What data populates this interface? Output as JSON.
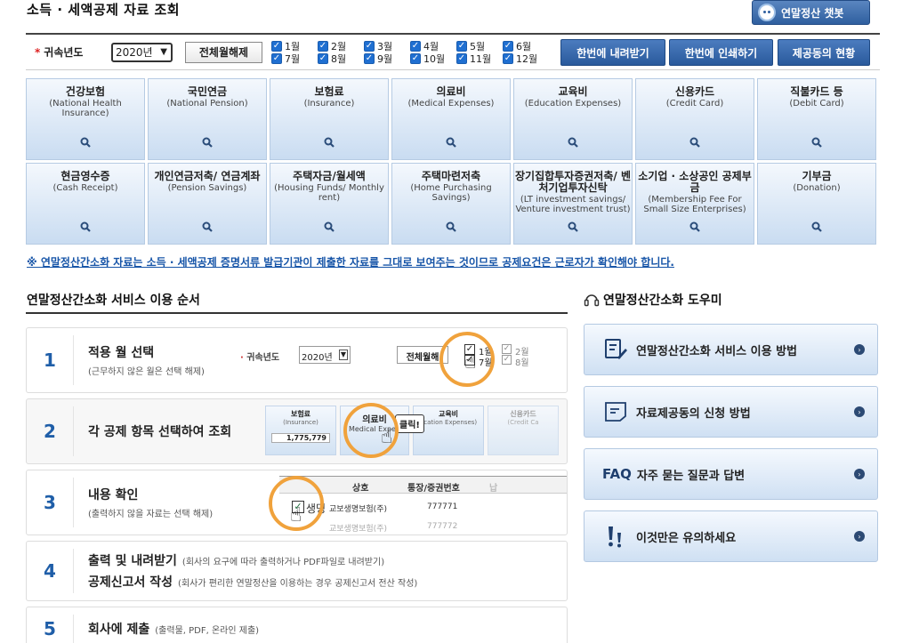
{
  "header": {
    "title": "소득 · 세액공제 자료 조회",
    "chatbot_label": "연말정산 챗봇"
  },
  "filter": {
    "year_label": "귀속년도",
    "required_mark": "*",
    "year_value": "2020년",
    "release_all": "전체월해제",
    "months": [
      "1월",
      "2월",
      "3월",
      "4월",
      "5월",
      "6월",
      "7월",
      "8월",
      "9월",
      "10월",
      "11월",
      "12월"
    ],
    "buttons": {
      "download_all": "한번에 내려받기",
      "print_all": "한번에 인쇄하기",
      "provider_status": "제공동의 현황"
    }
  },
  "categories": [
    {
      "ko": "건강보험",
      "en": "(National Health Insurance)"
    },
    {
      "ko": "국민연금",
      "en": "(National Pension)"
    },
    {
      "ko": "보험료",
      "en": "(Insurance)"
    },
    {
      "ko": "의료비",
      "en": "(Medical Expenses)"
    },
    {
      "ko": "교육비",
      "en": "(Education Expenses)"
    },
    {
      "ko": "신용카드",
      "en": "(Credit Card)"
    },
    {
      "ko": "직불카드 등",
      "en": "(Debit Card)"
    },
    {
      "ko": "현금영수증",
      "en": "(Cash Receipt)"
    },
    {
      "ko": "개인연금저축/ 연금계좌",
      "en": "(Pension Savings)"
    },
    {
      "ko": "주택자금/월세액",
      "en": "(Housing Funds/ Monthly rent)"
    },
    {
      "ko": "주택마련저축",
      "en": "(Home Purchasing Savings)"
    },
    {
      "ko": "장기집합투자증권저축/ 벤처기업투자신탁",
      "en": "(LT investment savings/ Venture investment trust)"
    },
    {
      "ko": "소기업 · 소상공인 공제부금",
      "en": "(Membership Fee For Small Size Enterprises)"
    },
    {
      "ko": "기부금",
      "en": "(Donation)"
    }
  ],
  "notice": "※ 연말정산간소화 자료는 소득 · 세액공제 증명서류 발급기관이 제출한 자료를 그대로 보여주는 것이므로 공제요건은 근로자가 확인해야 합니다.",
  "steps_section": {
    "title": "연말정산간소화 서비스 이용 순서"
  },
  "steps": [
    {
      "num": "1",
      "title": "적용 월 선택",
      "sub": "(근무하지 않은 월은 선택 해제)"
    },
    {
      "num": "2",
      "title": "각 공제 항목 선택하여 조회",
      "sub": ""
    },
    {
      "num": "3",
      "title": "내용 확인",
      "sub": "(출력하지 않을 자료는 선택 해제)"
    },
    {
      "num": "4",
      "title": "출력 및 내려받기",
      "title2": "공제신고서 작성",
      "sub": "(회사의 요구에 따라 출력하거나 PDF파일로 내려받기)",
      "sub2": "(회사가 편리한 연말정산을 이용하는 경우 공제신고서 전산 작성)"
    },
    {
      "num": "5",
      "title": "회사에 제출",
      "sub": "(출력물, PDF, 온라인 제출)"
    }
  ],
  "previews": {
    "step1": {
      "year_label": "귀속년도",
      "year_value": "2020년",
      "release": "전체월해",
      "m1": "1월",
      "m2": "2월",
      "m7": "7월",
      "m8": "8월"
    },
    "step2": {
      "c1_ko": "보험료",
      "c1_en": "(Insurance)",
      "c1_val": "1,775,779",
      "c2_ko": "의료비",
      "c2_en": "Medical Expen",
      "c3_ko": "교육비",
      "c3_en": "ucation Expenses)",
      "c4_ko": "신용카드",
      "c4_en": "(Credit Ca",
      "click": "클릭!"
    },
    "step3": {
      "h1": "상호",
      "h2": "통장/증권번호",
      "h3": "납",
      "row1_name": "생명",
      "row1_company": "교보생명보험(주)",
      "row1_no": "777771",
      "row2_company": "교보생명보험(주)",
      "row2_no": "777772"
    }
  },
  "help": {
    "title": "연말정산간소화 도우미",
    "items": [
      {
        "label": "연말정산간소화 서비스 이용 방법",
        "icon": "guide-pen-icon"
      },
      {
        "label": "자료제공동의 신청 방법",
        "icon": "document-icon"
      },
      {
        "prefix": "FAQ",
        "label": "자주 묻는 질문과 답변",
        "icon": "faq-icon"
      },
      {
        "label": "이것만은 유의하세요",
        "icon": "exclamation-icon"
      }
    ]
  },
  "colors": {
    "primary": "#2a5a9c",
    "link": "#1755a8",
    "highlight": "#f0a23c"
  }
}
